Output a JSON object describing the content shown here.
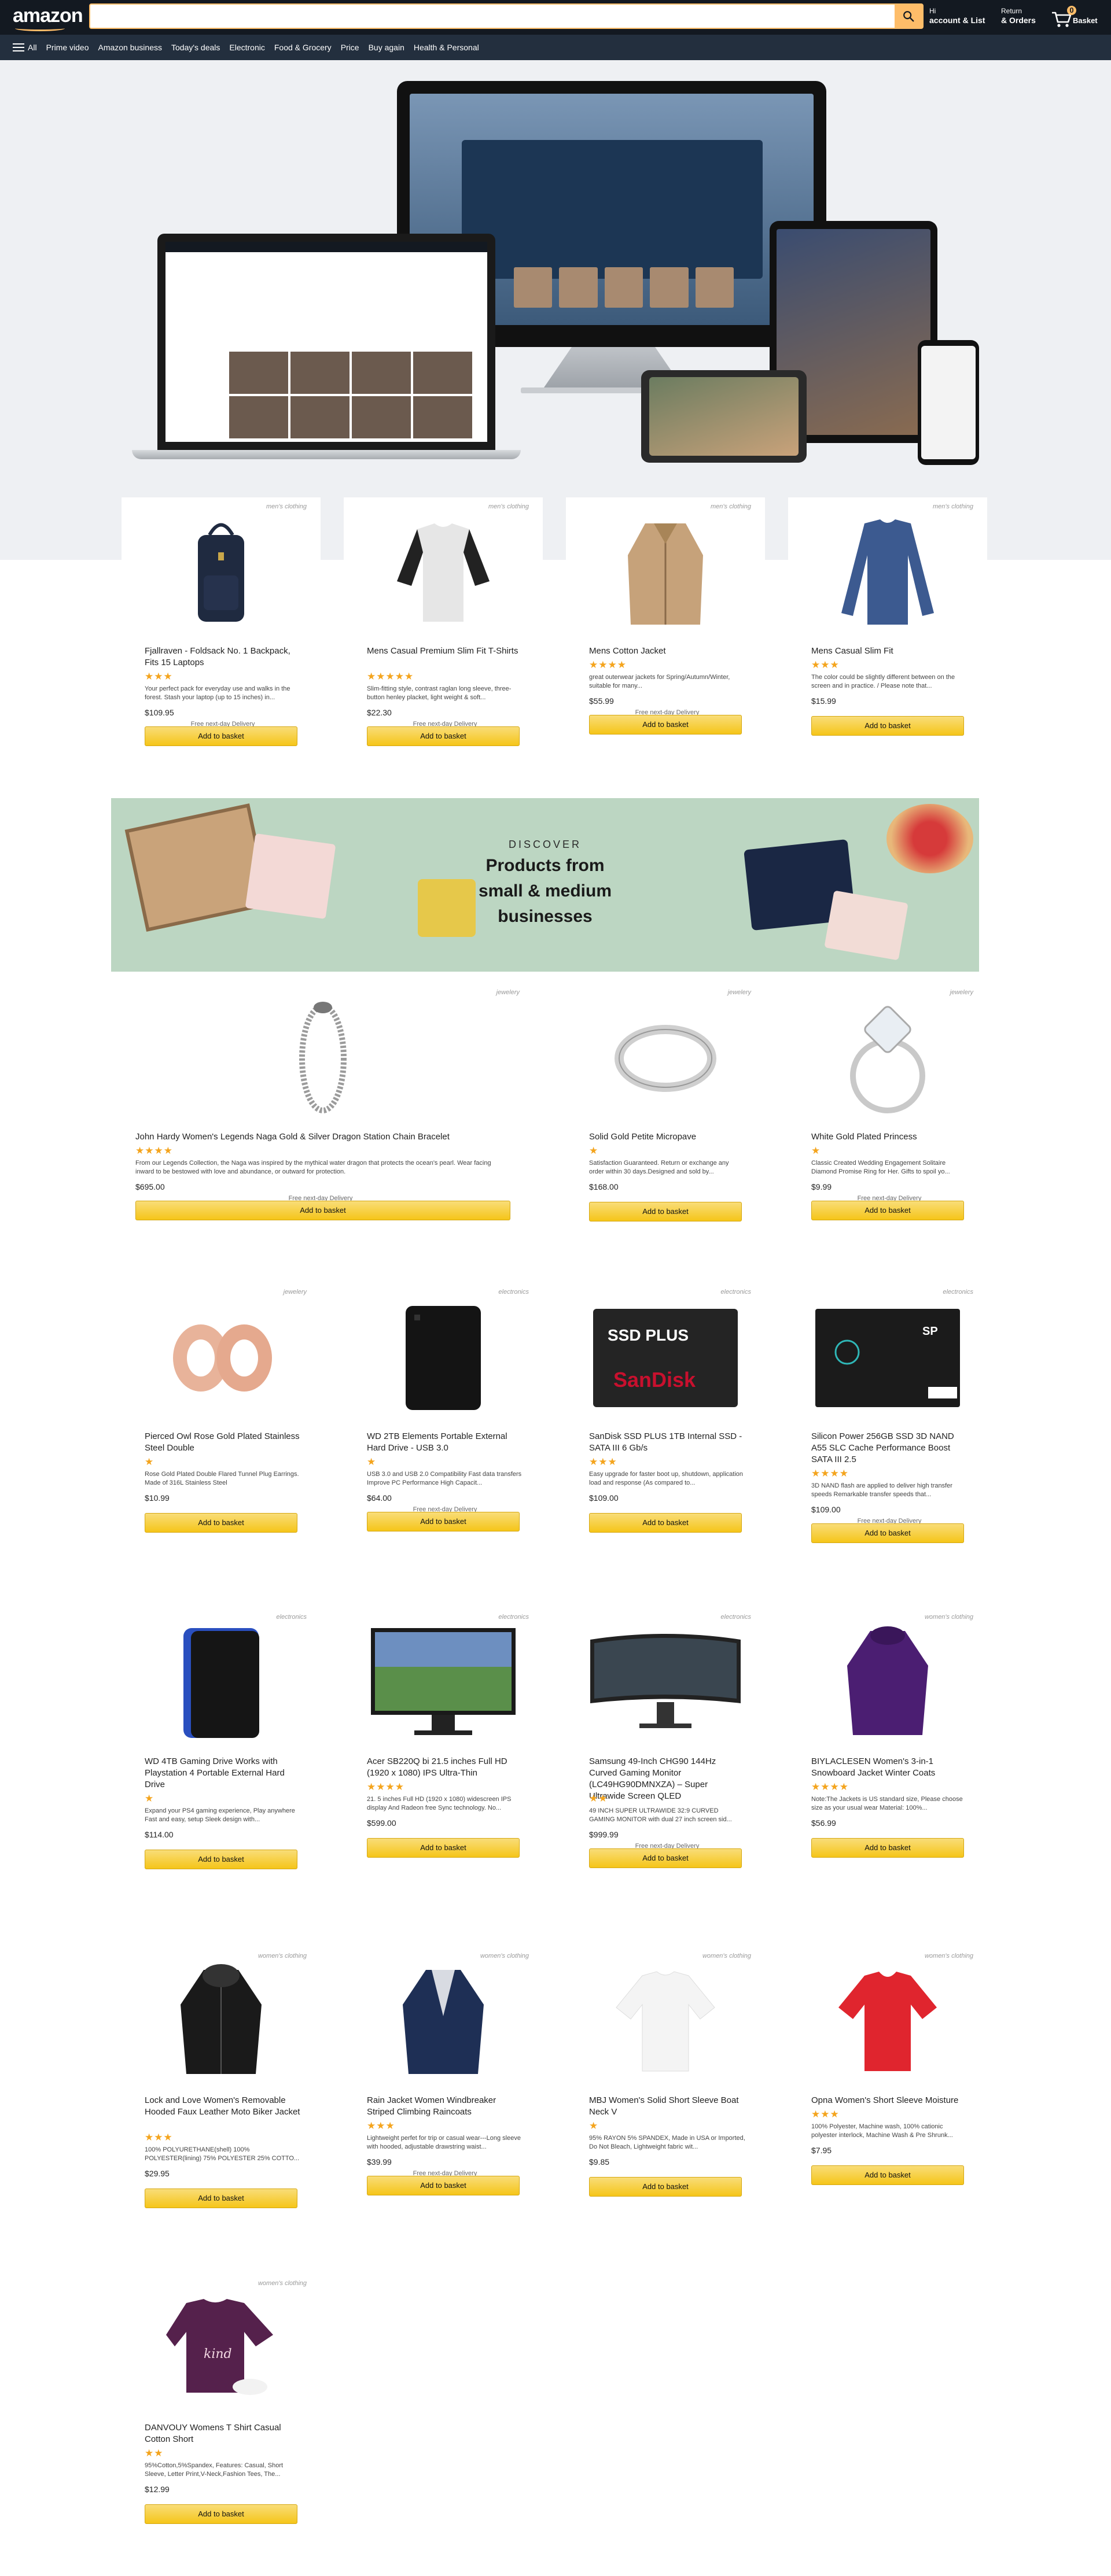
{
  "header": {
    "logo": "amazon",
    "search_placeholder": "",
    "account": {
      "line1": "Hi",
      "line2": "account & List"
    },
    "orders": {
      "line1": "Return",
      "line2": "& Orders"
    },
    "basket": {
      "count": "0",
      "label": "Basket"
    }
  },
  "nav": {
    "all": "All",
    "items": [
      "Prime video",
      "Amazon business",
      "Today's deals",
      "Electronic",
      "Food & Grocery",
      "Price",
      "Buy again",
      "Health & Personal"
    ]
  },
  "banner": {
    "discover": "DISCOVER",
    "headline1": "Products from",
    "headline2": "small & medium",
    "headline3": "businesses"
  },
  "common": {
    "add_to_basket": "Add to basket",
    "free_delivery": "Free next-day Delivery"
  },
  "products": [
    {
      "category": "men's clothing",
      "title": "Fjallraven - Foldsack No. 1 Backpack, Fits 15 Laptops",
      "stars": "★★★",
      "desc": "Your perfect pack for everyday use and walks in the forest. Stash your laptop (up to 15 inches) in...",
      "price": "$109.95",
      "delivery": "Free next-day Delivery"
    },
    {
      "category": "men's clothing",
      "title": "Mens Casual Premium Slim Fit T-Shirts",
      "stars": "★★★★★",
      "desc": "Slim-fitting style, contrast raglan long sleeve, three-button henley placket, light weight & soft...",
      "price": "$22.30",
      "delivery": "Free next-day Delivery"
    },
    {
      "category": "men's clothing",
      "title": "Mens Cotton Jacket",
      "stars": "★★★★",
      "desc": "great outerwear jackets for Spring/Autumn/Winter, suitable for many...",
      "price": "$55.99",
      "delivery": "Free next-day Delivery"
    },
    {
      "category": "men's clothing",
      "title": "Mens Casual Slim Fit",
      "stars": "★★★",
      "desc": "The color could be slightly different between on the screen and in practice. / Please note that...",
      "price": "$15.99",
      "delivery": ""
    },
    {
      "category": "jewelery",
      "title": "John Hardy Women's Legends Naga Gold & Silver Dragon Station Chain Bracelet",
      "stars": "★★★★",
      "desc": "From our Legends Collection, the Naga was inspired by the mythical water dragon that protects the ocean's pearl. Wear facing inward to be bestowed with love and abundance, or outward for protection.",
      "price": "$695.00",
      "delivery": "Free next-day Delivery"
    },
    {
      "category": "jewelery",
      "title": "Solid Gold Petite Micropave",
      "stars": "★",
      "desc": "Satisfaction Guaranteed. Return or exchange any order within 30 days.Designed and sold by...",
      "price": "$168.00",
      "delivery": ""
    },
    {
      "category": "jewelery",
      "title": "White Gold Plated Princess",
      "stars": "★",
      "desc": "Classic Created Wedding Engagement Solitaire Diamond Promise Ring for Her. Gifts to spoil yo...",
      "price": "$9.99",
      "delivery": "Free next-day Delivery"
    },
    {
      "category": "jewelery",
      "title": "Pierced Owl Rose Gold Plated Stainless Steel Double",
      "stars": "★",
      "desc": "Rose Gold Plated Double Flared Tunnel Plug Earrings. Made of 316L Stainless Steel",
      "price": "$10.99",
      "delivery": ""
    },
    {
      "category": "electronics",
      "title": "WD 2TB Elements Portable External Hard Drive - USB 3.0",
      "stars": "★",
      "desc": "USB 3.0 and USB 2.0 Compatibility Fast data transfers Improve PC Performance High Capacit...",
      "price": "$64.00",
      "delivery": "Free next-day Delivery"
    },
    {
      "category": "electronics",
      "title": "SanDisk SSD PLUS 1TB Internal SSD - SATA III 6 Gb/s",
      "stars": "★★★",
      "desc": "Easy upgrade for faster boot up, shutdown, application load and response (As compared to...",
      "price": "$109.00",
      "delivery": ""
    },
    {
      "category": "electronics",
      "title": "Silicon Power 256GB SSD 3D NAND A55 SLC Cache Performance Boost SATA III 2.5",
      "stars": "★★★★",
      "desc": "3D NAND flash are applied to deliver high transfer speeds Remarkable transfer speeds that...",
      "price": "$109.00",
      "delivery": "Free next-day Delivery"
    },
    {
      "category": "electronics",
      "title": "WD 4TB Gaming Drive Works with Playstation 4 Portable External Hard Drive",
      "stars": "★",
      "desc": "Expand your PS4 gaming experience, Play anywhere Fast and easy, setup Sleek design with...",
      "price": "$114.00",
      "delivery": ""
    },
    {
      "category": "electronics",
      "title": "Acer SB220Q bi 21.5 inches Full HD (1920 x 1080) IPS Ultra-Thin",
      "stars": "★★★★",
      "desc": "21. 5 inches Full HD (1920 x 1080) widescreen IPS display And Radeon free Sync technology. No...",
      "price": "$599.00",
      "delivery": ""
    },
    {
      "category": "electronics",
      "title": "Samsung 49-Inch CHG90 144Hz Curved Gaming Monitor (LC49HG90DMNXZA) – Super Ultrawide Screen QLED",
      "stars": "★★",
      "desc": "49 INCH SUPER ULTRAWIDE 32:9 CURVED GAMING MONITOR with dual 27 inch screen sid...",
      "price": "$999.99",
      "delivery": "Free next-day Delivery"
    },
    {
      "category": "women's clothing",
      "title": "BIYLACLESEN Women's 3-in-1 Snowboard Jacket Winter Coats",
      "stars": "★★★★",
      "desc": "Note:The Jackets is US standard size, Please choose size as your usual wear Material: 100%...",
      "price": "$56.99",
      "delivery": ""
    },
    {
      "category": "women's clothing",
      "title": "Lock and Love Women's Removable Hooded Faux Leather Moto Biker Jacket",
      "stars": "★★★",
      "desc": "100% POLYURETHANE(shell) 100% POLYESTER(lining) 75% POLYESTER 25% COTTO...",
      "price": "$29.95",
      "delivery": ""
    },
    {
      "category": "women's clothing",
      "title": "Rain Jacket Women Windbreaker Striped Climbing Raincoats",
      "stars": "★★★",
      "desc": "Lightweight perfet for trip or casual wear---Long sleeve with hooded, adjustable drawstring waist...",
      "price": "$39.99",
      "delivery": "Free next-day Delivery"
    },
    {
      "category": "women's clothing",
      "title": "MBJ Women's Solid Short Sleeve Boat Neck V",
      "stars": "★",
      "desc": "95% RAYON 5% SPANDEX, Made in USA or Imported, Do Not Bleach, Lightweight fabric wit...",
      "price": "$9.85",
      "delivery": ""
    },
    {
      "category": "women's clothing",
      "title": "Opna Women's Short Sleeve Moisture",
      "stars": "★★★",
      "desc": "100% Polyester, Machine wash, 100% cationic polyester interlock, Machine Wash & Pre Shrunk...",
      "price": "$7.95",
      "delivery": ""
    },
    {
      "category": "women's clothing",
      "title": "DANVOUY Womens T Shirt Casual Cotton Short",
      "stars": "★★",
      "desc": "95%Cotton,5%Spandex, Features: Casual, Short Sleeve, Letter Print,V-Neck,Fashion Tees, The...",
      "price": "$12.99",
      "delivery": ""
    }
  ]
}
